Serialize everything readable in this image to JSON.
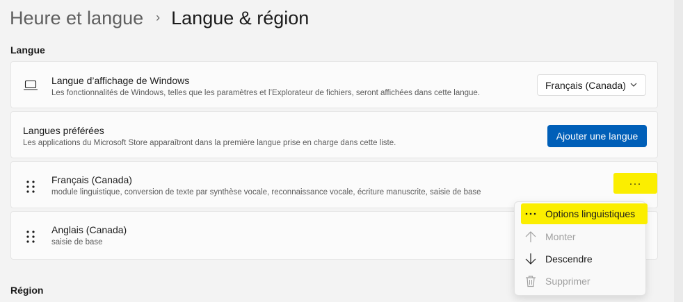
{
  "header": {
    "parent": "Heure et langue",
    "separator": "›",
    "current": "Langue & région"
  },
  "sections": {
    "langue": "Langue",
    "region": "Région"
  },
  "display_language": {
    "title": "Langue d’affichage de Windows",
    "description": "Les fonctionnalités de Windows, telles que les paramètres et l’Explorateur de fichiers, seront affichées dans cette langue.",
    "selected": "Français (Canada)",
    "icon": "monitor-icon"
  },
  "preferred_languages": {
    "title": "Langues préférées",
    "description": "Les applications du Microsoft Store apparaîtront dans la première langue prise en charge dans cette liste.",
    "add_button": "Ajouter une langue"
  },
  "languages": [
    {
      "name": "Français (Canada)",
      "features": "module linguistique, conversion de texte par synthèse vocale, reconnaissance vocale, écriture manuscrite, saisie de base"
    },
    {
      "name": "Anglais (Canada)",
      "features": "saisie de base"
    }
  ],
  "more_button": "···",
  "context_menu": {
    "items": [
      {
        "label": "Options linguistiques",
        "icon": "more-icon",
        "enabled": true
      },
      {
        "label": "Monter",
        "icon": "arrow-up-icon",
        "enabled": false
      },
      {
        "label": "Descendre",
        "icon": "arrow-down-icon",
        "enabled": true
      },
      {
        "label": "Supprimer",
        "icon": "trash-icon",
        "enabled": false
      }
    ]
  },
  "colors": {
    "accent": "#005fb8",
    "highlight": "#fbee00",
    "background": "#f3f3f3",
    "card": "#fbfbfb"
  }
}
